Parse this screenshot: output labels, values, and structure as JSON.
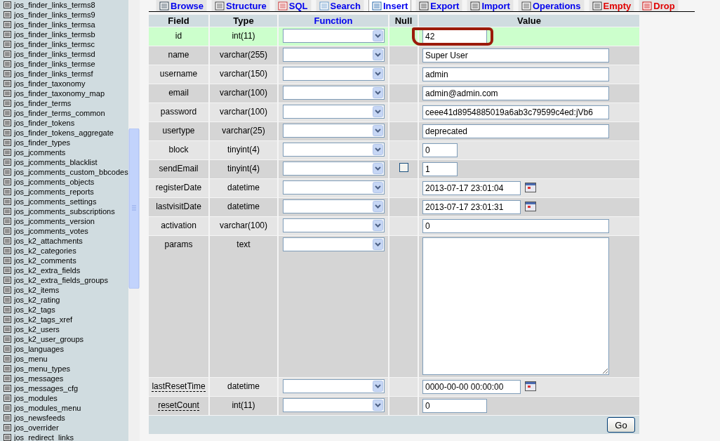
{
  "sidebar": {
    "items": [
      "jos_finder_links_terms8",
      "jos_finder_links_terms9",
      "jos_finder_links_termsa",
      "jos_finder_links_termsb",
      "jos_finder_links_termsc",
      "jos_finder_links_termsd",
      "jos_finder_links_termse",
      "jos_finder_links_termsf",
      "jos_finder_taxonomy",
      "jos_finder_taxonomy_map",
      "jos_finder_terms",
      "jos_finder_terms_common",
      "jos_finder_tokens",
      "jos_finder_tokens_aggregate",
      "jos_finder_types",
      "jos_jcomments",
      "jos_jcomments_blacklist",
      "jos_jcomments_custom_bbcodes",
      "jos_jcomments_objects",
      "jos_jcomments_reports",
      "jos_jcomments_settings",
      "jos_jcomments_subscriptions",
      "jos_jcomments_version",
      "jos_jcomments_votes",
      "jos_k2_attachments",
      "jos_k2_categories",
      "jos_k2_comments",
      "jos_k2_extra_fields",
      "jos_k2_extra_fields_groups",
      "jos_k2_items",
      "jos_k2_rating",
      "jos_k2_tags",
      "jos_k2_tags_xref",
      "jos_k2_users",
      "jos_k2_user_groups",
      "jos_languages",
      "jos_menu",
      "jos_menu_types",
      "jos_messages",
      "jos_messages_cfg",
      "jos_modules",
      "jos_modules_menu",
      "jos_newsfeeds",
      "jos_overrider",
      "jos_redirect_links"
    ]
  },
  "tabs": [
    {
      "label": "Browse",
      "kind": "browse",
      "danger": false,
      "selected": false
    },
    {
      "label": "Structure",
      "kind": "structure",
      "danger": false,
      "selected": false
    },
    {
      "label": "SQL",
      "kind": "sql",
      "danger": false,
      "selected": false
    },
    {
      "label": "Search",
      "kind": "search",
      "danger": false,
      "selected": false
    },
    {
      "label": "Insert",
      "kind": "insert",
      "danger": false,
      "selected": true
    },
    {
      "label": "Export",
      "kind": "export",
      "danger": false,
      "selected": false
    },
    {
      "label": "Import",
      "kind": "import",
      "danger": false,
      "selected": false
    },
    {
      "label": "Operations",
      "kind": "operations",
      "danger": false,
      "selected": false
    },
    {
      "label": "Empty",
      "kind": "empty",
      "danger": true,
      "selected": false
    },
    {
      "label": "Drop",
      "kind": "drop",
      "danger": true,
      "selected": false
    }
  ],
  "table": {
    "columns": [
      "Field",
      "Type",
      "Function",
      "Null",
      "Value"
    ],
    "rows": [
      {
        "field": "id",
        "type": "int(11)",
        "value": "42",
        "kind": "short",
        "highlighted": true,
        "circled": true,
        "commented": false
      },
      {
        "field": "name",
        "type": "varchar(255)",
        "value": "Super User",
        "kind": "long",
        "highlighted": false,
        "circled": false,
        "commented": false
      },
      {
        "field": "username",
        "type": "varchar(150)",
        "value": "admin",
        "kind": "long",
        "highlighted": false,
        "circled": false,
        "commented": false
      },
      {
        "field": "email",
        "type": "varchar(100)",
        "value": "admin@admin.com",
        "kind": "long",
        "highlighted": false,
        "circled": false,
        "commented": false
      },
      {
        "field": "password",
        "type": "varchar(100)",
        "value": "ceee41d8954885019a6ab3c79599c4ed:jVb6",
        "kind": "long",
        "highlighted": false,
        "circled": false,
        "commented": false
      },
      {
        "field": "usertype",
        "type": "varchar(25)",
        "value": "deprecated",
        "kind": "long",
        "highlighted": false,
        "circled": false,
        "commented": false
      },
      {
        "field": "block",
        "type": "tinyint(4)",
        "value": "0",
        "kind": "tiny",
        "highlighted": false,
        "circled": false,
        "commented": false
      },
      {
        "field": "sendEmail",
        "type": "tinyint(4)",
        "value": "1",
        "kind": "tiny",
        "highlighted": false,
        "circled": false,
        "commented": false,
        "null_checkbox": {
          "checked": false
        }
      },
      {
        "field": "registerDate",
        "type": "datetime",
        "value": "2013-07-17 23:01:04",
        "kind": "date",
        "highlighted": false,
        "circled": false,
        "commented": false
      },
      {
        "field": "lastvisitDate",
        "type": "datetime",
        "value": "2013-07-17 23:01:31",
        "kind": "date",
        "highlighted": false,
        "circled": false,
        "commented": false
      },
      {
        "field": "activation",
        "type": "varchar(100)",
        "value": "0",
        "kind": "long",
        "highlighted": false,
        "circled": false,
        "commented": false
      },
      {
        "field": "params",
        "type": "text",
        "value": "",
        "kind": "textarea",
        "highlighted": false,
        "circled": false,
        "commented": false
      },
      {
        "field": "lastResetTime",
        "type": "datetime",
        "value": "0000-00-00 00:00:00",
        "kind": "date",
        "highlighted": false,
        "circled": false,
        "commented": true
      },
      {
        "field": "resetCount",
        "type": "int(11)",
        "value": "0",
        "kind": "short",
        "highlighted": false,
        "circled": false,
        "commented": true
      }
    ]
  },
  "go_button": "Go"
}
